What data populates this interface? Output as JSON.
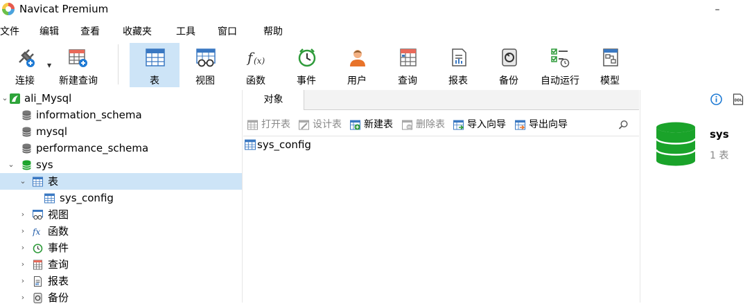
{
  "app": {
    "title": "Navicat Premium"
  },
  "window_controls": {
    "minimize": "–",
    "maximize": "☐",
    "close": "✕"
  },
  "menu": [
    "文件",
    "编辑",
    "查看",
    "收藏夹",
    "工具",
    "窗口",
    "帮助"
  ],
  "toolbar": [
    "连接",
    "新建查询",
    "表",
    "视图",
    "函数",
    "事件",
    "用户",
    "查询",
    "报表",
    "备份",
    "自动运行",
    "模型"
  ],
  "toolbar_active": "表",
  "tree": [
    {
      "label": "ali_Mysql",
      "icon": "connection-icon"
    },
    {
      "label": "information_schema",
      "icon": "database-icon"
    },
    {
      "label": "mysql",
      "icon": "database-icon"
    },
    {
      "label": "performance_schema",
      "icon": "database-icon"
    },
    {
      "label": "sys",
      "icon": "database-icon"
    },
    {
      "label": "表",
      "icon": "table-icon"
    },
    {
      "label": "sys_config",
      "icon": "table-icon"
    },
    {
      "label": "视图",
      "icon": "view-icon"
    },
    {
      "label": "函数",
      "icon": "function-icon"
    },
    {
      "label": "事件",
      "icon": "event-icon"
    },
    {
      "label": "查询",
      "icon": "query-icon"
    },
    {
      "label": "报表",
      "icon": "report-icon"
    },
    {
      "label": "备份",
      "icon": "backup-icon"
    }
  ],
  "tab": {
    "label": "对象"
  },
  "object_toolbar": [
    "打开表",
    "设计表",
    "新建表",
    "删除表",
    "导入向导",
    "导出向导"
  ],
  "objects": [
    "sys_config"
  ],
  "info_panel": {
    "name": "sys",
    "count": "1 表"
  },
  "colors": {
    "selection": "#cde4f7",
    "db_green": "#1aa32a",
    "accent_blue": "#1e7ad4"
  }
}
